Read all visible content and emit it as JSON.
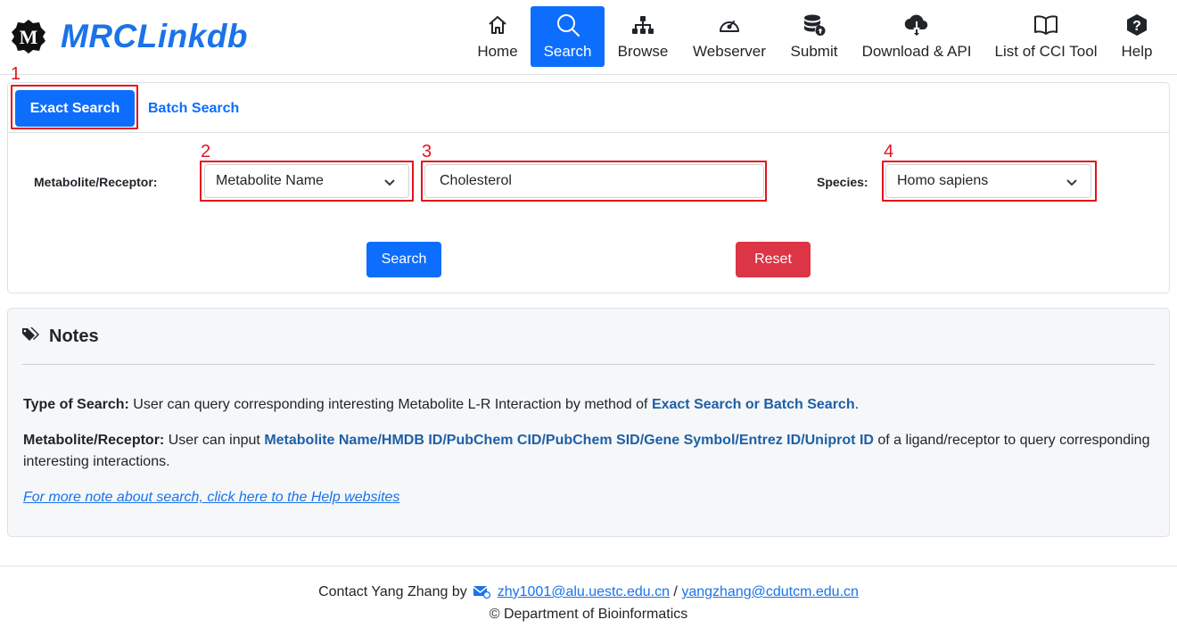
{
  "app": {
    "title": "MRCLinkdb",
    "logo_letter": "M"
  },
  "nav": [
    {
      "label": "Home",
      "icon": "home-icon"
    },
    {
      "label": "Search",
      "icon": "search-icon",
      "active": true
    },
    {
      "label": "Browse",
      "icon": "sitemap-icon"
    },
    {
      "label": "Webserver",
      "icon": "speedometer-icon"
    },
    {
      "label": "Submit",
      "icon": "database-upload-icon"
    },
    {
      "label": "Download & API",
      "icon": "cloud-download-icon"
    },
    {
      "label": "List of CCI Tool",
      "icon": "book-icon"
    },
    {
      "label": "Help",
      "icon": "question-icon"
    }
  ],
  "search": {
    "tabs": {
      "exact": "Exact Search",
      "batch": "Batch Search"
    },
    "annotations": [
      "1",
      "2",
      "3",
      "4"
    ],
    "metabolite_label": "Metabolite/Receptor:",
    "type_select_value": "Metabolite Name",
    "query_value": "Cholesterol",
    "species_label": "Species:",
    "species_value": "Homo sapiens",
    "search_button": "Search",
    "reset_button": "Reset"
  },
  "notes": {
    "title": "Notes",
    "type_label": "Type of Search:",
    "type_text": " User can query corresponding interesting Metabolite L-R Interaction by method of ",
    "type_highlight": "Exact Search or Batch Search",
    "type_end": ".",
    "meta_label": "Metabolite/Receptor:",
    "meta_text": " User can input ",
    "meta_highlight": "Metabolite Name/HMDB ID/PubChem CID/PubChem SID/Gene Symbol/Entrez ID/Uniprot ID",
    "meta_end": " of a ligand/receptor to query corresponding interesting interactions.",
    "help_link": "For more note about search, click here to the Help websites"
  },
  "footer": {
    "contact": "Contact Yang Zhang by",
    "email1": "zhy1001@alu.uestc.edu.cn",
    "separator": " / ",
    "email2": "yangzhang@cdutcm.edu.cn",
    "copyright": "© Department of Bioinformatics"
  },
  "colors": {
    "primary": "#0d6efd",
    "danger": "#dc3545",
    "annotation": "#e3141d",
    "logo": "#1a73e8"
  }
}
